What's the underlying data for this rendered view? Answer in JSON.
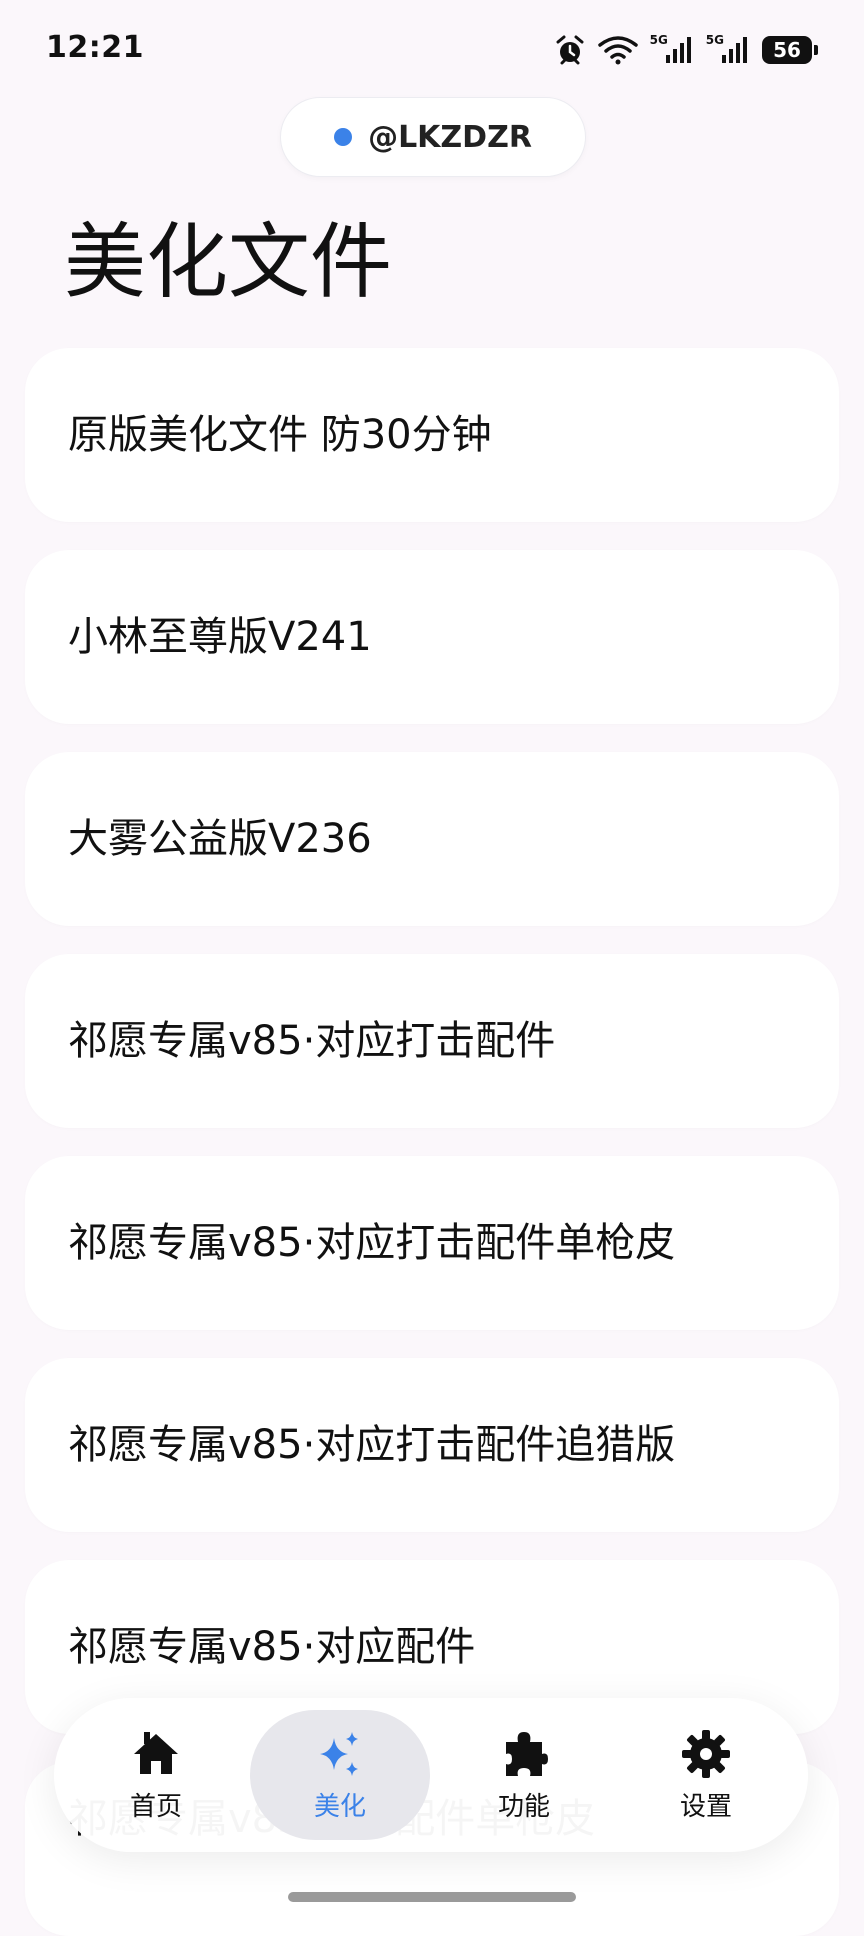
{
  "status_bar": {
    "time": "12:21",
    "signal_1_label": "5G",
    "signal_2_label": "5G",
    "battery": "56",
    "icons": [
      "alarm-icon",
      "wifi-icon",
      "signal-icon",
      "signal-icon",
      "battery-icon"
    ]
  },
  "account": {
    "name": "@LKZDZR",
    "dot_color": "#3b82e8"
  },
  "page": {
    "title": "美化文件"
  },
  "items": [
    {
      "label": "原版美化文件 防30分钟"
    },
    {
      "label": "小林至尊版V241"
    },
    {
      "label": "大雾公益版V236"
    },
    {
      "label": "祁愿专属v85·对应打击配件"
    },
    {
      "label": "祁愿专属v85·对应打击配件单枪皮"
    },
    {
      "label": "祁愿专属v85·对应打击配件追猎版"
    },
    {
      "label": "祁愿专属v85·对应配件"
    },
    {
      "label": "祁愿专属v85·对应配件单枪皮"
    }
  ],
  "nav": {
    "accent_color": "#3b82e8",
    "items": [
      {
        "label": "首页",
        "icon": "home-icon"
      },
      {
        "label": "美化",
        "icon": "sparkle-icon",
        "active": true
      },
      {
        "label": "功能",
        "icon": "puzzle-icon"
      },
      {
        "label": "设置",
        "icon": "gear-icon"
      }
    ]
  }
}
